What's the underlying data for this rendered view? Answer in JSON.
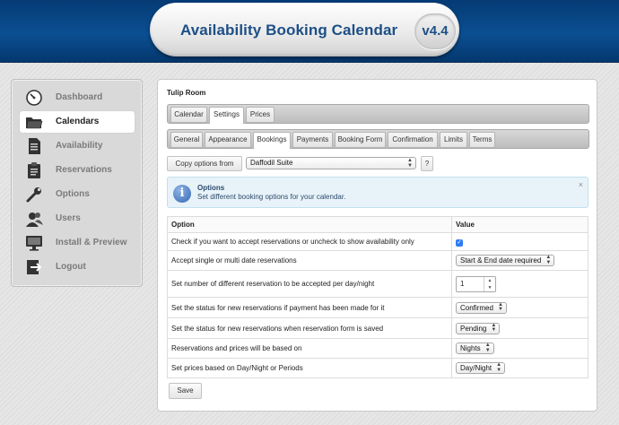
{
  "header": {
    "title": "Availability Booking Calendar",
    "version": "v4.4"
  },
  "sidebar": {
    "items": [
      {
        "label": "Dashboard",
        "icon": "dashboard-icon",
        "active": false
      },
      {
        "label": "Calendars",
        "icon": "folder-icon",
        "active": true
      },
      {
        "label": "Availability",
        "icon": "document-icon",
        "active": false
      },
      {
        "label": "Reservations",
        "icon": "clipboard-icon",
        "active": false
      },
      {
        "label": "Options",
        "icon": "wrench-icon",
        "active": false
      },
      {
        "label": "Users",
        "icon": "users-icon",
        "active": false
      },
      {
        "label": "Install & Preview",
        "icon": "monitor-icon",
        "active": false
      },
      {
        "label": "Logout",
        "icon": "logout-icon",
        "active": false
      }
    ]
  },
  "main": {
    "calendar_name": "Tulip Room",
    "primary_tabs": [
      "Calendar",
      "Settings",
      "Prices"
    ],
    "primary_active": "Settings",
    "secondary_tabs": [
      "General",
      "Appearance",
      "Bookings",
      "Payments",
      "Booking Form",
      "Confirmation",
      "Limits",
      "Terms"
    ],
    "secondary_active": "Bookings",
    "copy_button": "Copy options from",
    "copy_select_value": "Daffodil Suite",
    "help_button": "?",
    "info": {
      "title": "Options",
      "text": "Set different booking options for your calendar.",
      "close": "×"
    },
    "table": {
      "headers": {
        "option": "Option",
        "value": "Value"
      },
      "rows": [
        {
          "label": "Check if you want to accept reservations or uncheck to show availability only",
          "type": "checkbox",
          "value": "checked"
        },
        {
          "label": "Accept single or multi date reservations",
          "type": "select",
          "value": "Start & End date required"
        },
        {
          "label": "Set number of different reservation to be accepted per day/night",
          "type": "stepper",
          "value": "1"
        },
        {
          "label": "Set the status for new reservations if payment has been made for it",
          "type": "select",
          "value": "Confirmed"
        },
        {
          "label": "Set the status for new reservations when reservation form is saved",
          "type": "select",
          "value": "Pending"
        },
        {
          "label": "Reservations and prices will be based on",
          "type": "select",
          "value": "Nights"
        },
        {
          "label": "Set prices based on Day/Night or Periods",
          "type": "select",
          "value": "Day/Night"
        }
      ]
    },
    "save_button": "Save"
  },
  "colors": {
    "header_blue": "#0b4f92",
    "title_blue": "#1d4f86",
    "checkbox_blue": "#2e7cf6",
    "info_bg": "#e8f3f9"
  }
}
